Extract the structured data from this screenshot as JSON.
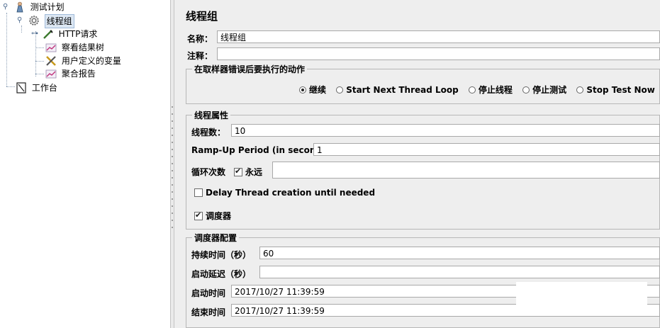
{
  "tree": {
    "nodes": [
      {
        "label": "测试计划",
        "icon": "test-plan-icon"
      },
      {
        "label": "线程组",
        "icon": "gear-icon"
      },
      {
        "label": "HTTP请求",
        "icon": "pipette-icon"
      },
      {
        "label": "察看结果树",
        "icon": "chart-icon"
      },
      {
        "label": "用户定义的变量",
        "icon": "tools-icon"
      },
      {
        "label": "聚合报告",
        "icon": "chart-icon"
      },
      {
        "label": "工作台",
        "icon": "workbench-icon"
      }
    ]
  },
  "panel": {
    "title": "线程组",
    "name_label": "名称：",
    "name_value": "线程组",
    "comment_label": "注释：",
    "comment_value": "",
    "error_action": {
      "title": "在取样器错误后要执行的动作",
      "options": [
        "继续",
        "Start Next Thread Loop",
        "停止线程",
        "停止测试",
        "Stop Test Now"
      ],
      "selected": "继续"
    },
    "thread_props": {
      "title": "线程属性",
      "threads_label": "线程数：",
      "threads_value": "10",
      "rampup_label": "Ramp-Up Period (in seconds):",
      "rampup_value": "1",
      "loop_label": "循环次数",
      "forever_label": "永远",
      "forever_checked": true,
      "loop_value": "",
      "delay_label": "Delay Thread creation until needed",
      "delay_checked": false,
      "scheduler_label": "调度器",
      "scheduler_checked": true
    },
    "scheduler": {
      "title": "调度器配置",
      "duration_label": "持续时间（秒）",
      "duration_value": "60",
      "delay_label": "启动延迟（秒）",
      "delay_value": "",
      "start_label": "启动时间",
      "start_value": "2017/10/27 11:39:59",
      "end_label": "结束时间",
      "end_value": "2017/10/27 11:39:59"
    }
  }
}
